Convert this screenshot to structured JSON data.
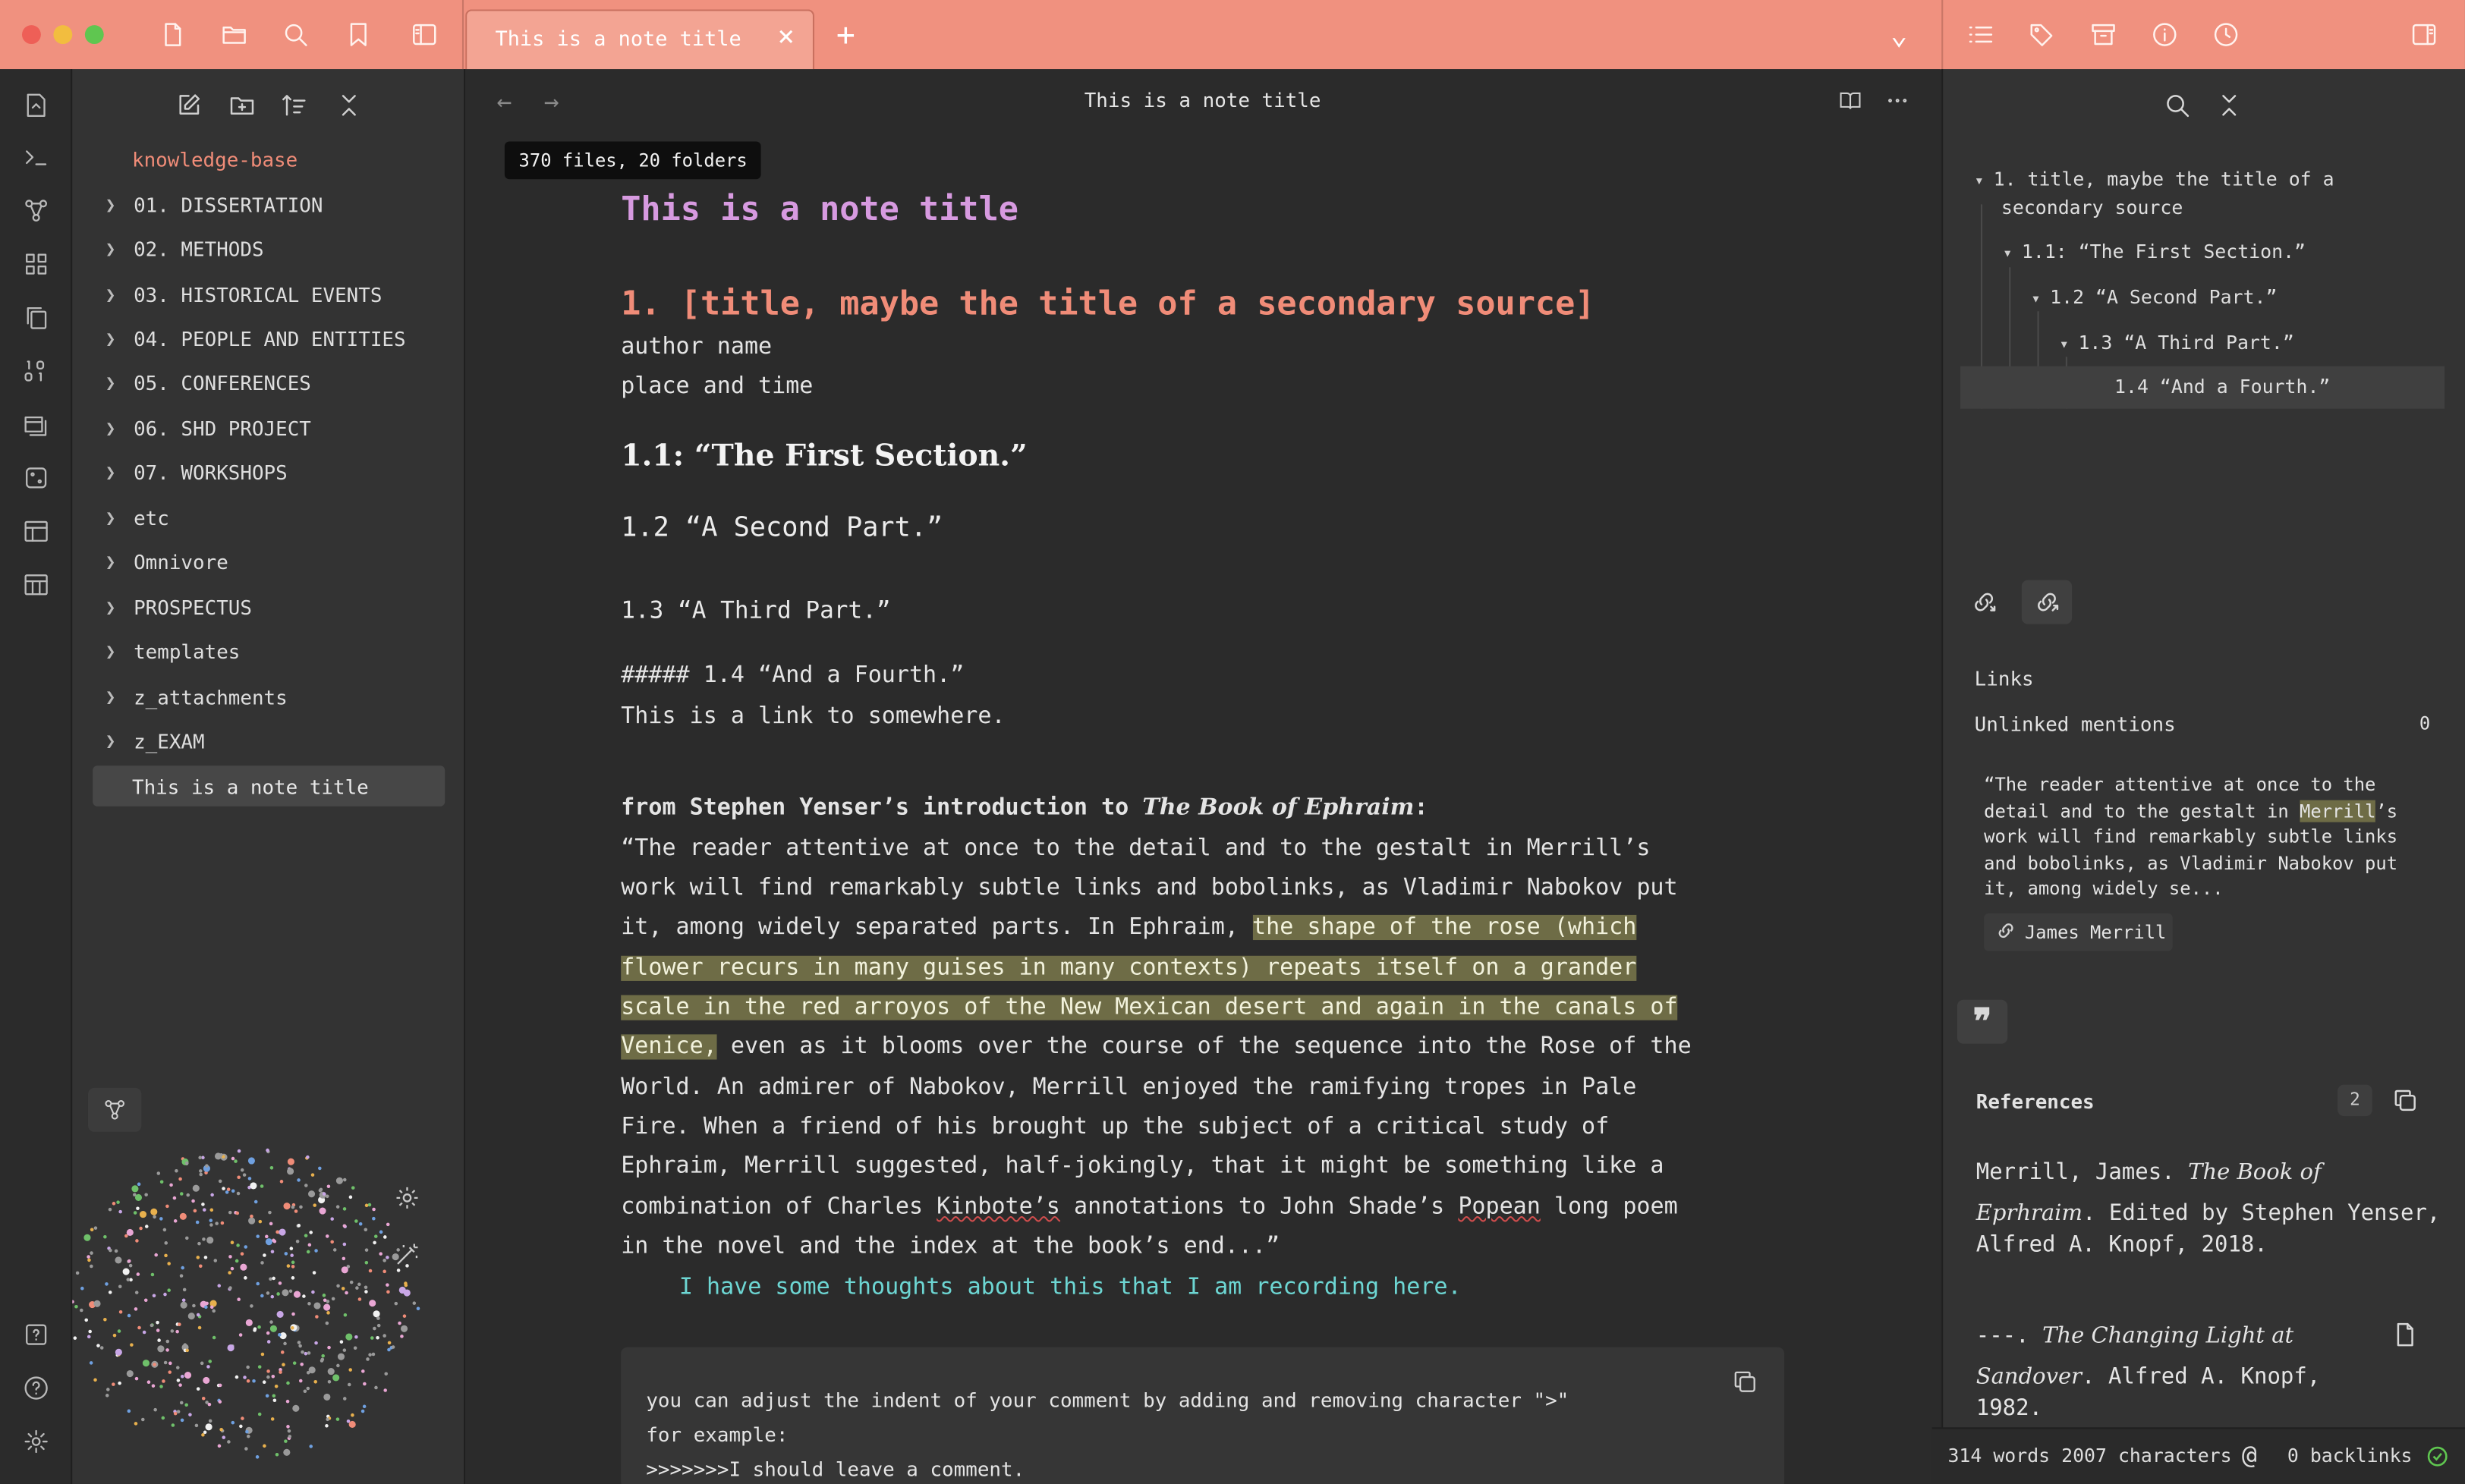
{
  "colors": {
    "accent": "#f0917f",
    "heading_note": "#d79ae0",
    "heading_h1": "#f08c78",
    "highlight": "#6e6c46",
    "link_teal": "#6dd6d3",
    "background": "#2b2b2b",
    "panel": "#333333"
  },
  "titlebar": {
    "left_icons": [
      "new-file-icon",
      "folder-icon",
      "search-icon",
      "bookmark-icon",
      "sidebar-toggle-icon"
    ],
    "tab_title": "This is a note title",
    "tab_close": "×",
    "new_tab": "+",
    "tab_list": "⌄",
    "right_icons": [
      "outline-icon",
      "tags-icon",
      "archive-icon",
      "info-icon",
      "history-icon",
      "right-sidebar-toggle-icon"
    ]
  },
  "ribbon": {
    "icons": [
      "open-folder-icon",
      "terminal-icon",
      "graph-view-icon",
      "dashboard-icon",
      "copy-icon",
      "binary-icon",
      "slides-icon",
      "dice-icon",
      "layout-icon",
      "table-icon"
    ],
    "bottom_icons": [
      "help-vault-icon",
      "help-icon",
      "settings-icon"
    ]
  },
  "explorer": {
    "tool_icons": [
      "new-note-icon",
      "new-folder-icon",
      "sort-icon",
      "collapse-icon"
    ],
    "vault_name": "knowledge-base",
    "tooltip": "370 files, 20 folders",
    "folders": [
      "01. DISSERTATION",
      "02. METHODS",
      "03. HISTORICAL EVENTS",
      "04. PEOPLE AND ENTITIES",
      "05. CONFERENCES",
      "06. SHD PROJECT",
      "07. WORKSHOPS",
      "etc",
      "Omnivore",
      "PROSPECTUS",
      "templates",
      "z_attachments",
      "z_EXAM"
    ],
    "active_file": "This is a note title"
  },
  "editor": {
    "view_title": "This is a note title",
    "note_title": "This is a note title",
    "h1": "1. [title, maybe the title of a secondary source]",
    "author": "author name",
    "place": "place and time",
    "h2": "1.1: “The First Section.”",
    "h3": "1.2 “A Second Part.”",
    "h4": "1.3 “A Third Part.”",
    "raw_heading": "##### 1.4 “And a Fourth.”",
    "link_line": "This is a link to somewhere.",
    "quote_intro_a": "from Stephen Yenser’s introduction to ",
    "quote_intro_book": "The Book of Ephraim",
    "quote_intro_b": ":",
    "q1": "“The reader attentive at once to the detail and to the gestalt in Merrill’s",
    "q2": "work will find remarkably subtle links and bobolinks, as Vladimir Nabokov put",
    "q3a": "it, among widely separated parts. In Ephraim, ",
    "q3b": "the shape of the rose (which",
    "q4": "flower recurs in many guises in many contexts) repeats itself on a grander",
    "q5": "scale in the red arroyos of the New Mexican desert and again in the canals of",
    "q6a": "Venice,",
    "q6b": " even as it blooms over the course of the sequence into the Rose of the",
    "q7": "World. An admirer of Nabokov, Merrill enjoyed the ramifying tropes in Pale",
    "q8": "Fire. When a friend of his brought up the subject of a critical study of",
    "q9": "Ephraim, Merrill suggested, half-jokingly, that it might be something like a",
    "q10a": "combination of Charles ",
    "q10b": "Kinbote’s",
    "q10c": " annotations to John Shade’s ",
    "q10d": "Popean",
    "q10e": " long poem",
    "q11": "in the novel and the index at the book’s end...”",
    "comment": "I have some thoughts about this that I am recording here.",
    "code1": "you can adjust the indent of your comment by adding and removing character \">\"",
    "code2": "for example:",
    "code3": ">>>>>>>I should leave a comment."
  },
  "outline": {
    "items": [
      "1. title, maybe the title of a",
      "secondary source",
      "1.1: “The First Section.”",
      "1.2 “A Second Part.”",
      "1.3 “A Third Part.”",
      "1.4 “And a Fourth.”"
    ]
  },
  "backlinks": {
    "links_label": "Links",
    "unlinked_label": "Unlinked mentions",
    "unlinked_count": "0",
    "snippet_a": "“The reader attentive at once to the detail and to the gestalt in ",
    "snippet_mark": "Merrill",
    "snippet_b": "’s work will find remarkably subtle links and bobolinks, as Vladimir Nabokov put it, among widely se...",
    "tag_button": "James Merrill"
  },
  "references": {
    "title": "References",
    "count": "2",
    "ref1_a": "Merrill, James. ",
    "ref1_title_1": "The Book of",
    "ref1_title_2": "Eprhraim",
    "ref1_b": ". Edited by Stephen Yenser,",
    "ref1_c": "Alfred A. Knopf, 2018.",
    "ref2_a": "---. ",
    "ref2_title_1": "The Changing Light at",
    "ref2_title_2": "Sandover",
    "ref2_b": ". Alfred A. Knopf,",
    "ref2_c": "1982."
  },
  "status": {
    "counts": "314 words 2007 characters",
    "at": "@",
    "backlinks": "0 backlinks"
  }
}
